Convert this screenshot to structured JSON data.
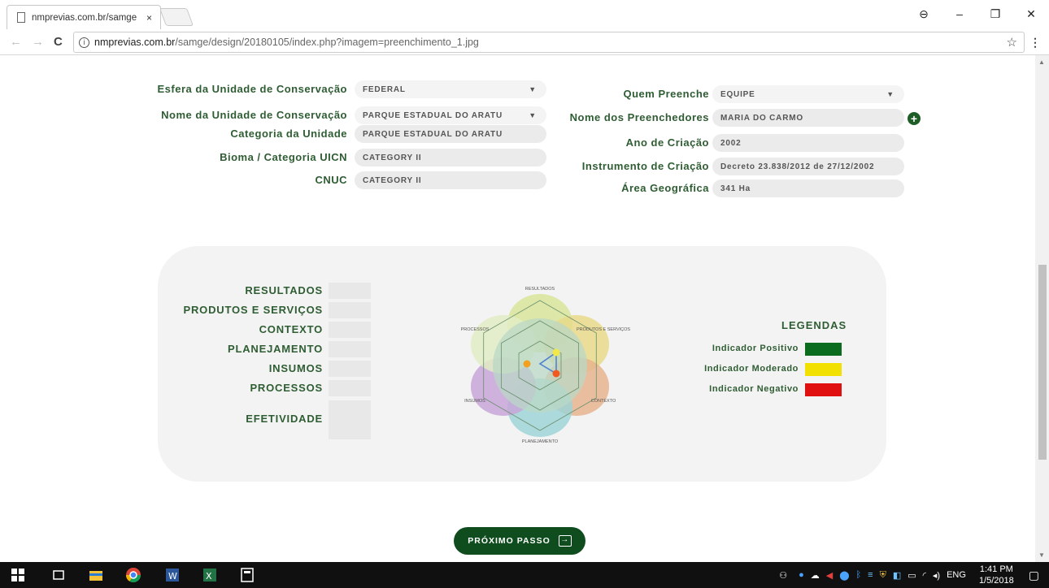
{
  "browser": {
    "tab_title": "nmprevias.com.br/samge",
    "tab_close": "×",
    "url_host": "nmprevias.com.br",
    "url_path": "/samge/design/20180105/index.php?imagem=preenchimento_1.jpg",
    "back": "←",
    "forward": "→",
    "reload": "C",
    "info": "i",
    "star": "☆",
    "menu": "⋮",
    "minimize": "–",
    "restore": "❐",
    "close": "✕",
    "profile": "⊖"
  },
  "form_left": [
    {
      "label": "Esfera da Unidade de Conservação",
      "value": "FEDERAL",
      "select": true
    },
    {
      "label": "Nome da Unidade de Conservação",
      "value": "PARQUE ESTADUAL DO ARATU",
      "select": true
    },
    {
      "label": "Categoria da Unidade",
      "value": "PARQUE ESTADUAL DO ARATU",
      "select": false
    },
    {
      "label": "Bioma / Categoria UICN",
      "value": "CATEGORY II",
      "select": false
    },
    {
      "label": "CNUC",
      "value": "CATEGORY II",
      "select": false
    }
  ],
  "form_right": [
    {
      "label": "Quem Preenche",
      "value": "EQUIPE",
      "select": true
    },
    {
      "label": "Nome dos Preenchedores",
      "value": "MARIA DO CARMO",
      "select": false
    },
    {
      "label": "Ano de Criação",
      "value": "2002",
      "select": false
    },
    {
      "label": "Instrumento de Criação",
      "value": "Decreto 23.838/2012 de 27/12/2002",
      "select": false
    },
    {
      "label": "Área Geográfica",
      "value": "341 Ha",
      "select": false
    }
  ],
  "add_button": "+",
  "results": {
    "rows": [
      "RESULTADOS",
      "PRODUTOS E SERVIÇOS",
      "CONTEXTO",
      "PLANEJAMENTO",
      "INSUMOS",
      "PROCESSOS"
    ],
    "effectiveness": "EFETIVIDADE"
  },
  "radar": {
    "axes": [
      "RESULTADOS",
      "PRODUTOS E SERVIÇOS",
      "CONTEXTO",
      "PLANEJAMENTO",
      "INSUMOS",
      "PROCESSOS"
    ],
    "colors": [
      "#d8e59a",
      "#e8d98a",
      "#e6b48e",
      "#9fd3d6",
      "#c7a4d8",
      "#e2ecc4"
    ]
  },
  "legend": {
    "title": "LEGENDAS",
    "items": [
      {
        "label": "Indicador Positivo",
        "color": "#0b6b1e"
      },
      {
        "label": "Indicador Moderado",
        "color": "#f2e000"
      },
      {
        "label": "Indicador Negativo",
        "color": "#e01010"
      }
    ]
  },
  "next_button": "PRÓXIMO PASSO",
  "taskbar": {
    "lang": "ENG",
    "time": "1:41 PM",
    "date": "1/5/2018"
  }
}
